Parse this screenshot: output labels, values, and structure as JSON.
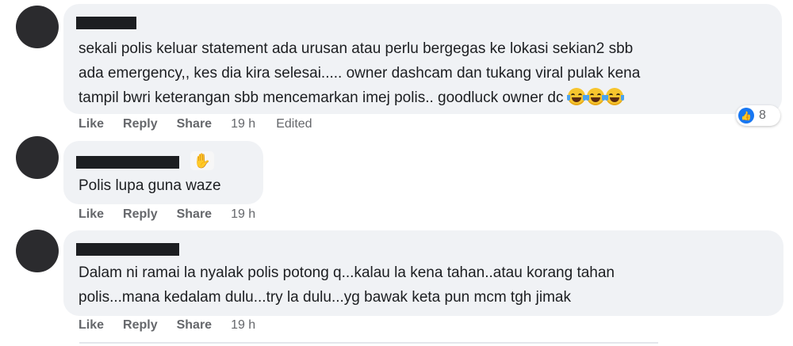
{
  "comments": [
    {
      "lines": [
        "sekali polis keluar statement ada urusan atau perlu bergegas ke lokasi sekian2 sbb",
        "ada emergency,, kes dia kira selesai..... owner dashcam dan tukang viral pulak kena",
        "tampil bwri keterangan sbb mencemarkan imej polis.. goodluck owner dc"
      ],
      "emoji": [
        "face-with-tears-of-joy",
        "face-with-tears-of-joy",
        "face-with-tears-of-joy"
      ],
      "actions": {
        "like": "Like",
        "reply": "Reply",
        "share": "Share"
      },
      "time": "19 h",
      "edited": "Edited",
      "reactions": {
        "icon": "like-icon",
        "count": "8"
      }
    },
    {
      "badge_icon": "waving-hand-icon",
      "lines": [
        "Polis lupa guna waze"
      ],
      "actions": {
        "like": "Like",
        "reply": "Reply",
        "share": "Share"
      },
      "time": "19 h"
    },
    {
      "lines": [
        "Dalam ni ramai la nyalak polis potong q...kalau la kena tahan..atau korang tahan",
        "polis...mana kedalam dulu...try la dulu...yg bawak keta pun mcm tgh jimak"
      ],
      "actions": {
        "like": "Like",
        "reply": "Reply",
        "share": "Share"
      },
      "time": "19 h"
    }
  ],
  "colors": {
    "bubble": "#f0f2f5",
    "text": "#1c1e21",
    "secondary": "#65676b",
    "like_blue": "#1877f2",
    "redaction": "#1c1e21"
  }
}
